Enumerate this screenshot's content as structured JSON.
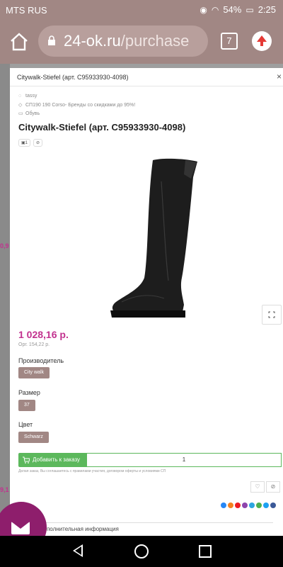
{
  "status": {
    "carrier": "MTS RUS",
    "battery": "54%",
    "time": "2:25"
  },
  "browser": {
    "url_domain": "24-ok.ru",
    "url_path": "/purchase",
    "tab_count": "7"
  },
  "modal": {
    "header_title": "Citywalk-Stiefel (арт. C95933930-4098)",
    "close": "×",
    "meta": [
      "tassy",
      "СП190 190 Corso- Бренды со скидками до 95%!",
      "Обувь"
    ],
    "title": "Citywalk-Stiefel (арт. C95933930-4098)",
    "image_count": "1",
    "price": "1 028,16 р.",
    "org_price": "Орг. 154,22 р.",
    "fields": [
      {
        "label": "Производитель",
        "value": "City walk"
      },
      {
        "label": "Размер",
        "value": "37"
      },
      {
        "label": "Цвет",
        "value": "Schwarz"
      }
    ],
    "add_button": "Добавить к заказу",
    "quantity": "1",
    "terms": "Делая заказ, Вы соглашаетесь с правилами участия, договором оферты и условиями СП",
    "more_info": "Дополнительная информация"
  },
  "share_colors": [
    "#2787f5",
    "#f58220",
    "#ed1c24",
    "#8e44ad",
    "#2ca5e0",
    "#4caf50",
    "#1da1f2",
    "#3b5998"
  ],
  "colors": {
    "accent": "#a18784",
    "price": "#c2328f",
    "add_green": "#5cb85c",
    "fab": "#8e1e6c"
  }
}
